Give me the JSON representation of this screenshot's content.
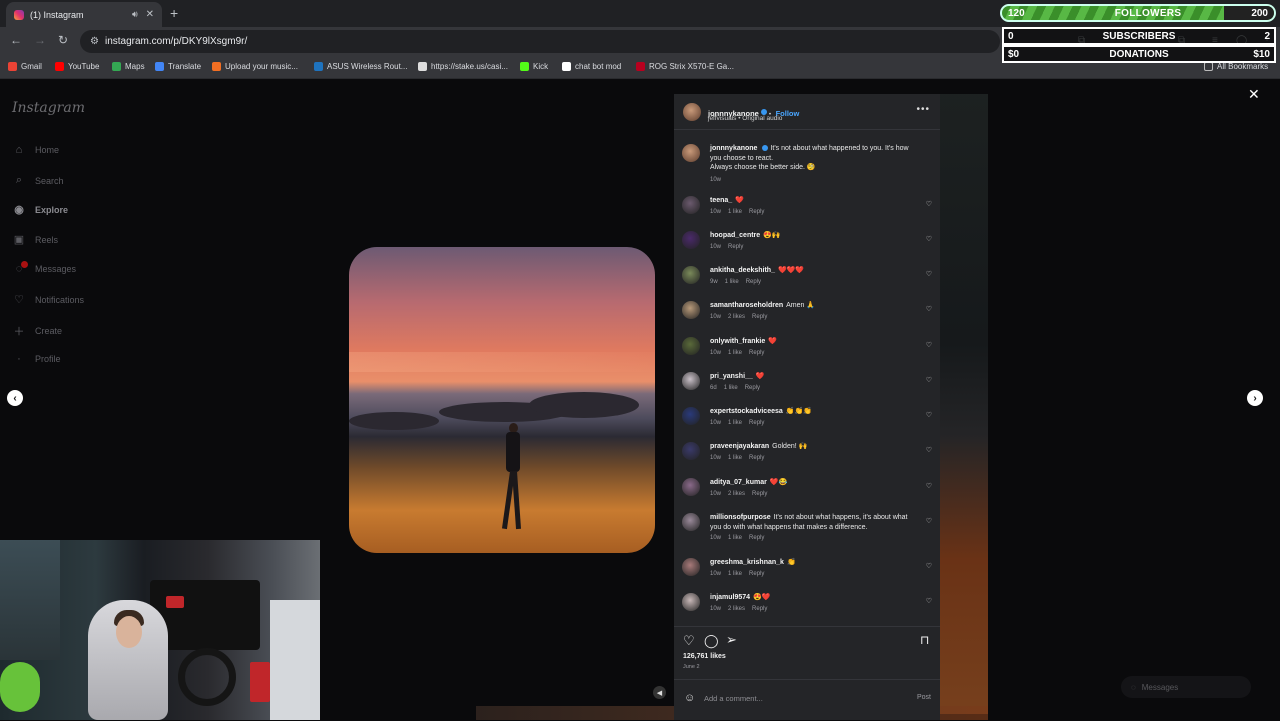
{
  "browser": {
    "tab_title": "(1) Instagram",
    "url": "instagram.com/p/DKY9lXsgm9r/",
    "bookmarks": [
      {
        "label": "Gmail",
        "color": "#ea4335"
      },
      {
        "label": "YouTube",
        "color": "#ff0000"
      },
      {
        "label": "Maps",
        "color": "#34a853"
      },
      {
        "label": "Translate",
        "color": "#4285f4"
      },
      {
        "label": "Upload your music...",
        "color": "#f26f23"
      },
      {
        "label": "ASUS Wireless Rout...",
        "color": "#1e73be"
      },
      {
        "label": "https://stake.us/casi...",
        "color": "#dddddd"
      },
      {
        "label": "Kick",
        "color": "#53fc18"
      },
      {
        "label": "chat bot mod",
        "color": "#ffffff"
      },
      {
        "label": "ROG Strix X570-E Ga...",
        "color": "#b8001f"
      }
    ],
    "all_bookmarks": "All Bookmarks"
  },
  "overlay": {
    "followers_current": "120",
    "followers_label": "FOLLOWERS",
    "followers_goal": "200",
    "subscribers_current": "0",
    "subscribers_label": "SUBSCRIBERS",
    "subscribers_goal": "2",
    "donations_current": "$0",
    "donations_label": "DONATIONS",
    "donations_goal": "$10"
  },
  "instagram": {
    "logo": "Instagram",
    "nav": [
      {
        "label": "Home",
        "icon": "home-icon"
      },
      {
        "label": "Search",
        "icon": "search-icon"
      },
      {
        "label": "Explore",
        "icon": "compass-icon"
      },
      {
        "label": "Reels",
        "icon": "reels-icon"
      },
      {
        "label": "Messages",
        "icon": "messenger-icon"
      },
      {
        "label": "Notifications",
        "icon": "heart-icon"
      },
      {
        "label": "Create",
        "icon": "plus-icon"
      },
      {
        "label": "Profile",
        "icon": "avatar-icon"
      }
    ],
    "post": {
      "author": "jonnnykanone",
      "follow_label": "Follow",
      "subline": "jeffvisuals • Original audio",
      "caption_line1": "It's not about what happened to you. It's how you choose to react.",
      "caption_line2": "Always choose the better side. 🧐",
      "caption_time": "10w",
      "likes": "126,761 likes",
      "date": "June 2",
      "add_comment_placeholder": "Add a comment...",
      "post_label": "Post"
    },
    "comments": [
      {
        "user": "teena_",
        "text": "❤️",
        "time": "10w",
        "likes": "1 like",
        "reply": "Reply"
      },
      {
        "user": "hoopad_centre",
        "text": "😍🙌",
        "time": "10w",
        "likes": "",
        "reply": "Reply"
      },
      {
        "user": "ankitha_deekshith_",
        "text": "❤️❤️❤️",
        "time": "9w",
        "likes": "1 like",
        "reply": "Reply"
      },
      {
        "user": "samantharoseholdren",
        "text": "Amen 🙏",
        "time": "10w",
        "likes": "2 likes",
        "reply": "Reply"
      },
      {
        "user": "onlywith_frankie",
        "text": "❤️",
        "time": "10w",
        "likes": "1 like",
        "reply": "Reply"
      },
      {
        "user": "pri_yanshi__",
        "text": "❤️",
        "time": "6d",
        "likes": "1 like",
        "reply": "Reply"
      },
      {
        "user": "expertstockadviceesa",
        "text": "👏👏👏",
        "time": "10w",
        "likes": "1 like",
        "reply": "Reply"
      },
      {
        "user": "praveenjayakaran",
        "text": "Golden! 🙌",
        "time": "10w",
        "likes": "1 like",
        "reply": "Reply"
      },
      {
        "user": "aditya_07_kumar",
        "text": "❤️😂",
        "time": "10w",
        "likes": "2 likes",
        "reply": "Reply"
      },
      {
        "user": "millionsofpurpose",
        "text": "It's not about what happens, it's about what you do with what happens that makes a difference.",
        "time": "10w",
        "likes": "1 like",
        "reply": "Reply"
      },
      {
        "user": "greeshma_krishnan_k",
        "text": "👏",
        "time": "10w",
        "likes": "1 like",
        "reply": "Reply"
      },
      {
        "user": "injamul9574",
        "text": "😍❤️",
        "time": "10w",
        "likes": "2 likes",
        "reply": "Reply"
      }
    ],
    "messages_pill": "Messages"
  }
}
